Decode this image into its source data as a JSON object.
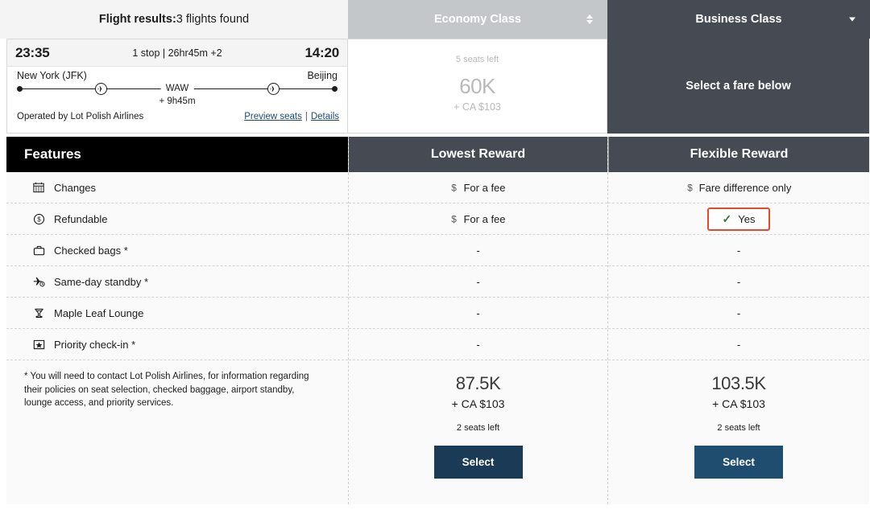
{
  "header": {
    "results_label": "Flight results:",
    "results_count": "3 flights found",
    "tabs": [
      {
        "label": "Economy Class",
        "state": "inactive",
        "icon": "updown-caret-icon"
      },
      {
        "label": "Business Class",
        "state": "active",
        "icon": "chevron-down-icon"
      }
    ]
  },
  "flight": {
    "depart_time": "23:35",
    "stops_summary": "1 stop | 26hr45m +2",
    "arrive_time": "14:20",
    "origin": "New York (JFK)",
    "destination": "Beijing",
    "layover_code": "WAW",
    "layover_duration": "+ 9h45m",
    "operated_by": "Operated by Lot Polish Airlines",
    "preview_seats_link": "Preview seats",
    "link_separator": "|",
    "details_link": "Details"
  },
  "economy_panel": {
    "seats_left": "5 seats left",
    "price": "60K",
    "tax": "+ CA $103",
    "disabled": true
  },
  "business_panel": {
    "message": "Select a fare below"
  },
  "table": {
    "features_header": "Features",
    "column_headers": [
      "Lowest Reward",
      "Flexible Reward"
    ],
    "rows": [
      {
        "icon": "calendar-icon",
        "label": "Changes",
        "lowest": "For a fee",
        "lowest_icon": "dollar-icon",
        "flexible": "Fare difference only",
        "flexible_icon": "dollar-icon",
        "highlighted": false
      },
      {
        "icon": "dollar-circle-icon",
        "label": "Refundable",
        "lowest": "For a fee",
        "lowest_icon": "dollar-icon",
        "flexible": "Yes",
        "flexible_icon": "check-icon",
        "highlighted": true
      },
      {
        "icon": "briefcase-icon",
        "label": "Checked bags *",
        "lowest": "-",
        "lowest_icon": "",
        "flexible": "-",
        "flexible_icon": "",
        "highlighted": false
      },
      {
        "icon": "standby-plane-icon",
        "label": "Same-day standby *",
        "lowest": "-",
        "lowest_icon": "",
        "flexible": "-",
        "flexible_icon": "",
        "highlighted": false
      },
      {
        "icon": "lounge-icon",
        "label": "Maple Leaf Lounge",
        "lowest": "-",
        "lowest_icon": "",
        "flexible": "-",
        "flexible_icon": "",
        "highlighted": false
      },
      {
        "icon": "star-box-icon",
        "label": "Priority check-in *",
        "lowest": "-",
        "lowest_icon": "",
        "flexible": "-",
        "flexible_icon": "",
        "highlighted": false
      }
    ]
  },
  "footer": {
    "disclaimer": "* You will need to contact Lot Polish Airlines, for information regarding their policies on seat selection, checked baggage, airport standby, lounge access, and priority services.",
    "fares": [
      {
        "price": "87.5K",
        "tax": "+ CA $103",
        "seats_left": "2 seats left",
        "button_label": "Select",
        "button_color": "#1b3a56"
      },
      {
        "price": "103.5K",
        "tax": "+ CA $103",
        "seats_left": "2 seats left",
        "button_label": "Select",
        "button_color": "#1f4d70"
      }
    ]
  },
  "colors": {
    "tab_active": "#464b53",
    "tab_inactive": "#c3c7ca",
    "features_header_bg": "#000000",
    "highlight_border": "#e8492a",
    "check_green": "#2a7a36",
    "link_blue": "#1b4a73"
  }
}
